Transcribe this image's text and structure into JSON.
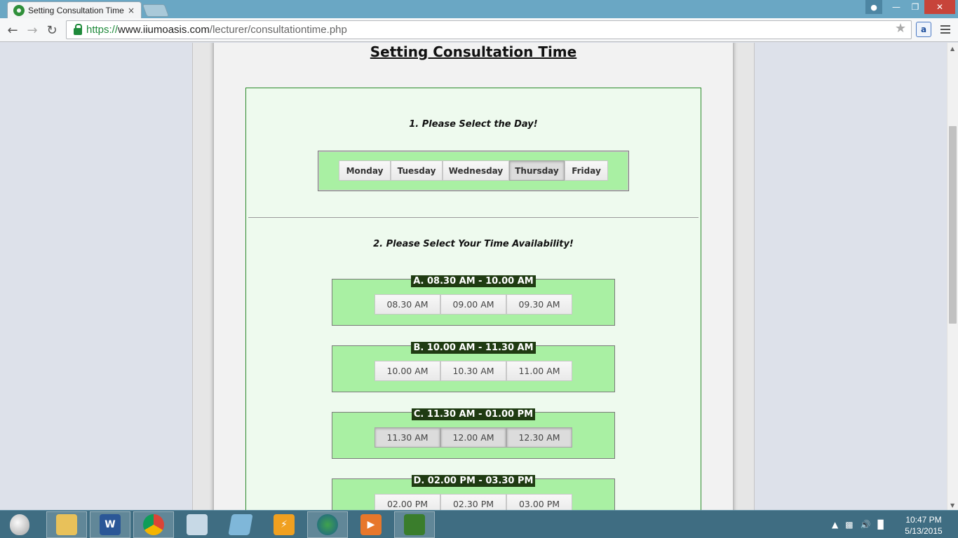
{
  "browser": {
    "tab_title": "Setting Consultation Time",
    "tab_close": "×",
    "url_scheme": "https://",
    "url_host": "www.iiumoasis.com",
    "url_path": "/lecturer/consultationtime.php",
    "icons": [
      "back-arrow-icon",
      "forward-arrow-icon",
      "reload-icon",
      "lock-icon",
      "star-icon",
      "extension-icon",
      "menu-icon"
    ]
  },
  "page": {
    "title": "Setting Consultation Time",
    "step1_label": "1. Please Select the Day!",
    "step2_label": "2. Please Select Your Time Availability!",
    "days": [
      {
        "label": "Monday",
        "selected": false
      },
      {
        "label": "Tuesday",
        "selected": false
      },
      {
        "label": "Wednesday",
        "selected": false
      },
      {
        "label": "Thursday",
        "selected": true
      },
      {
        "label": "Friday",
        "selected": false
      }
    ],
    "slot_groups": [
      {
        "legend": "A. 08.30 AM - 10.00 AM",
        "times": [
          "08.30 AM",
          "09.00 AM",
          "09.30 AM"
        ],
        "selected": false
      },
      {
        "legend": "B. 10.00 AM - 11.30 AM",
        "times": [
          "10.00 AM",
          "10.30 AM",
          "11.00 AM"
        ],
        "selected": false
      },
      {
        "legend": "C. 11.30 AM - 01.00 PM",
        "times": [
          "11.30 AM",
          "12.00 AM",
          "12.30 AM"
        ],
        "selected": true
      },
      {
        "legend": "D. 02.00 PM - 03.30 PM",
        "times": [
          "02.00 PM",
          "02.30 PM",
          "03.00 PM"
        ],
        "selected": false
      }
    ]
  },
  "taskbar": {
    "time": "10:47 PM",
    "date": "5/13/2015",
    "extension_badge": "a"
  }
}
